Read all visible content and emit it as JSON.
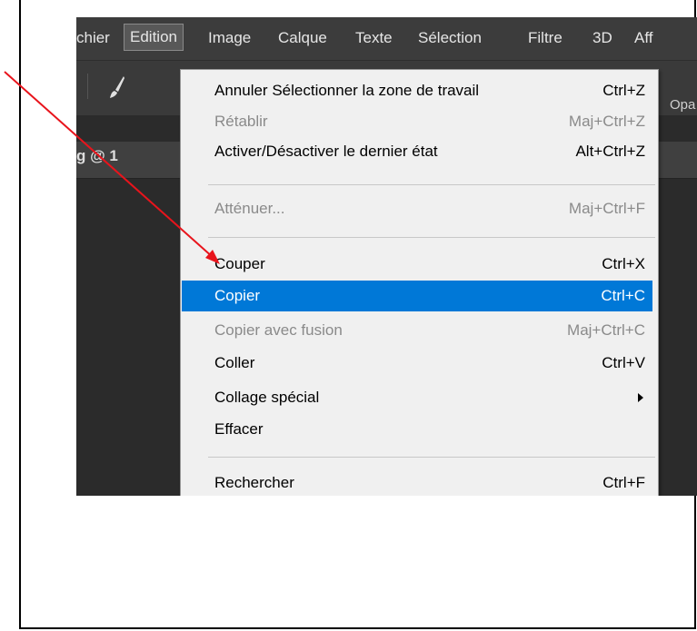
{
  "menubar": {
    "items": [
      {
        "label": "chier",
        "active": false
      },
      {
        "label": "Edition",
        "active": true
      },
      {
        "label": "Image",
        "active": false
      },
      {
        "label": "Calque",
        "active": false
      },
      {
        "label": "Texte",
        "active": false
      },
      {
        "label": "Sélection",
        "active": false
      },
      {
        "label": "Filtre",
        "active": false
      },
      {
        "label": "3D",
        "active": false
      },
      {
        "label": "Aff",
        "active": false
      }
    ]
  },
  "toolbar": {
    "tool_icon": "brush-icon",
    "dropdown_icon": "chevron-down-icon",
    "opacity_label": "Opa"
  },
  "document_tab": {
    "label": "g @ 1"
  },
  "edit_menu": {
    "items": [
      {
        "label": "Annuler Sélectionner la zone de travail",
        "shortcut": "Ctrl+Z",
        "state": "enabled"
      },
      {
        "label": "Rétablir",
        "shortcut": "Maj+Ctrl+Z",
        "state": "disabled"
      },
      {
        "label": "Activer/Désactiver le dernier état",
        "shortcut": "Alt+Ctrl+Z",
        "state": "enabled"
      },
      {
        "label": "Atténuer...",
        "shortcut": "Maj+Ctrl+F",
        "state": "disabled"
      },
      {
        "label": "Couper",
        "shortcut": "Ctrl+X",
        "state": "enabled"
      },
      {
        "label": "Copier",
        "shortcut": "Ctrl+C",
        "state": "highlighted"
      },
      {
        "label": "Copier avec fusion",
        "shortcut": "Maj+Ctrl+C",
        "state": "disabled"
      },
      {
        "label": "Coller",
        "shortcut": "Ctrl+V",
        "state": "enabled"
      },
      {
        "label": "Collage spécial",
        "shortcut": "",
        "state": "enabled",
        "submenu_icon": "submenu-arrow-icon"
      },
      {
        "label": "Effacer",
        "shortcut": "",
        "state": "enabled"
      },
      {
        "label": "Rechercher",
        "shortcut": "Ctrl+F",
        "state": "enabled"
      }
    ]
  },
  "annotation": {
    "color": "#e8141c",
    "icon": "red-arrow-pointer"
  }
}
